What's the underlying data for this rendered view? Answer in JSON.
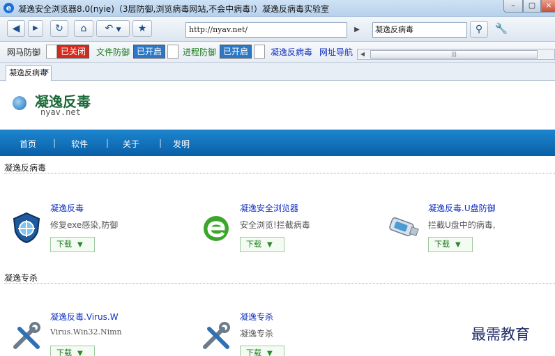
{
  "window": {
    "title": "凝逸安全浏览器8.0(nyie)（3层防御,浏览病毒网站,不会中病毒!）凝逸反病毒实验室",
    "app_icon": "e"
  },
  "toolbar": {
    "address": "http://nyav.net/",
    "search_value": "凝逸反病毒"
  },
  "protection": {
    "web_label": "网马防御",
    "web_status": "已关闭",
    "file_label": "文件防御",
    "file_status": "已开启",
    "process_label": "进程防御",
    "process_status": "已开启",
    "link_antivirus": "凝逸反病毒",
    "link_nav": "网址导航",
    "colors": {
      "closed": "#d42a1e",
      "open": "#2b78c8"
    }
  },
  "tabs": [
    {
      "label": "凝逸反病毒"
    }
  ],
  "site": {
    "logo_name": "凝逸反毒",
    "logo_domain": "nyav.net",
    "nav": [
      "首页",
      "软件",
      "关于",
      "发明"
    ]
  },
  "sections": [
    {
      "title": "凝逸反病毒",
      "items": [
        {
          "title": "凝逸反毒",
          "desc": "修复exe感染,防御",
          "button": "下载",
          "icon": "shield-icon"
        },
        {
          "title": "凝逸安全浏览器",
          "desc": "安全浏览!拦截病毒",
          "button": "下载",
          "icon": "browser-e-icon"
        },
        {
          "title": "凝逸反毒.U盘防御",
          "desc": "拦截U盘中的病毒,",
          "button": "下载",
          "icon": "usb-drive-icon"
        }
      ]
    },
    {
      "title": "凝逸专杀",
      "items": [
        {
          "title": "凝逸反毒.Virus.W",
          "desc": "Virus.Win32.Nimn",
          "button": "下载",
          "icon": "tools-icon"
        },
        {
          "title": "凝逸专杀",
          "desc": "凝逸专杀",
          "button": "下载",
          "icon": "tools-icon"
        }
      ]
    }
  ],
  "watermark": "最需教育"
}
